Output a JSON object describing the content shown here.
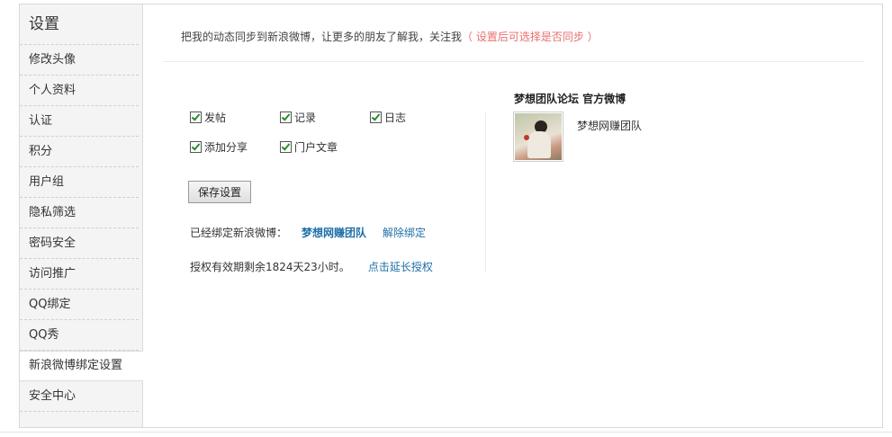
{
  "sidebar": {
    "title": "设置",
    "items": [
      {
        "label": "修改头像"
      },
      {
        "label": "个人资料"
      },
      {
        "label": "认证"
      },
      {
        "label": "积分"
      },
      {
        "label": "用户组"
      },
      {
        "label": "隐私筛选"
      },
      {
        "label": "密码安全"
      },
      {
        "label": "访问推广"
      },
      {
        "label": "QQ绑定"
      },
      {
        "label": "QQ秀"
      },
      {
        "label": "新浪微博绑定设置"
      },
      {
        "label": "安全中心"
      }
    ],
    "active_item": "新浪微博绑定设置"
  },
  "intro": {
    "text": "把我的动态同步到新浪微博，让更多的朋友了解我，关注我",
    "hint": "（ 设置后可选择是否同步 ）"
  },
  "sync_options": [
    {
      "label": "发帖",
      "checked": true
    },
    {
      "label": "记录",
      "checked": true
    },
    {
      "label": "日志",
      "checked": true
    },
    {
      "label": "添加分享",
      "checked": true
    },
    {
      "label": "门户文章",
      "checked": true
    }
  ],
  "save_button": "保存设置",
  "binding": {
    "label": "已经绑定新浪微博：",
    "account": "梦想网赚团队",
    "unbind": "解除绑定"
  },
  "authorization": {
    "text": "授权有效期剩余1824天23小时。",
    "extend": "点击延长授权"
  },
  "official": {
    "title": "梦想团队论坛 官方微博",
    "name": "梦想网赚团队"
  },
  "colors": {
    "link": "#1f6fa8",
    "hint": "#e96f6f",
    "check": "#2a8a2a"
  }
}
